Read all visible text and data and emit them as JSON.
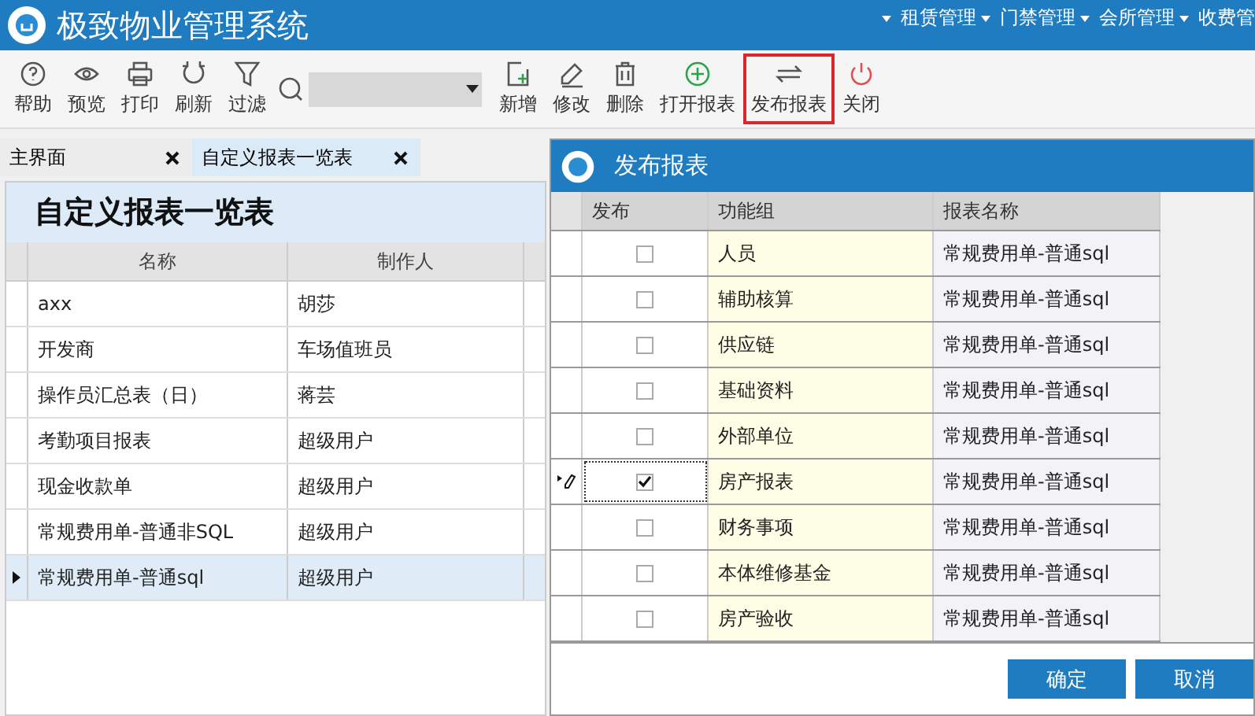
{
  "window": {
    "title": "极致物业管理系统"
  },
  "menus": [
    {
      "label": "租赁管理"
    },
    {
      "label": "门禁管理"
    },
    {
      "label": "会所管理"
    },
    {
      "label": "收费管"
    }
  ],
  "toolbar": {
    "left": [
      {
        "label": "帮助"
      },
      {
        "label": "预览"
      },
      {
        "label": "打印"
      },
      {
        "label": "刷新"
      },
      {
        "label": "过滤"
      }
    ],
    "right": [
      {
        "label": "新增",
        "highlighted": false
      },
      {
        "label": "修改",
        "highlighted": false
      },
      {
        "label": "删除",
        "highlighted": false
      },
      {
        "label": "打开报表",
        "highlighted": false
      },
      {
        "label": "发布报表",
        "highlighted": true
      },
      {
        "label": "关闭",
        "highlighted": false
      }
    ]
  },
  "tabs": [
    {
      "label": "主界面",
      "selected": false
    },
    {
      "label": "自定义报表一览表",
      "selected": true
    }
  ],
  "report_list": {
    "title": "自定义报表一览表",
    "columns": [
      "名称",
      "制作人"
    ],
    "rows": [
      {
        "name": "axx",
        "author": "胡莎",
        "selected": false
      },
      {
        "name": "开发商",
        "author": "车场值班员",
        "selected": false
      },
      {
        "name": "操作员汇总表（日）",
        "author": "蒋芸",
        "selected": false
      },
      {
        "name": "考勤项目报表",
        "author": "超级用户",
        "selected": false
      },
      {
        "name": "现金收款单",
        "author": "超级用户",
        "selected": false
      },
      {
        "name": "常规费用单-普通非SQL",
        "author": "超级用户",
        "selected": false
      },
      {
        "name": "常规费用单-普通sql",
        "author": "超级用户",
        "selected": true
      }
    ]
  },
  "dialog": {
    "title": "发布报表",
    "columns": [
      "发布",
      "功能组",
      "报表名称"
    ],
    "rows": [
      {
        "checked": false,
        "group": "人员",
        "report": "常规费用单-普通sql",
        "selected": false
      },
      {
        "checked": false,
        "group": "辅助核算",
        "report": "常规费用单-普通sql",
        "selected": false
      },
      {
        "checked": false,
        "group": "供应链",
        "report": "常规费用单-普通sql",
        "selected": false
      },
      {
        "checked": false,
        "group": "基础资料",
        "report": "常规费用单-普通sql",
        "selected": false
      },
      {
        "checked": false,
        "group": "外部单位",
        "report": "常规费用单-普通sql",
        "selected": false
      },
      {
        "checked": true,
        "group": "房产报表",
        "report": "常规费用单-普通sql",
        "selected": true
      },
      {
        "checked": false,
        "group": "财务事项",
        "report": "常规费用单-普通sql",
        "selected": false
      },
      {
        "checked": false,
        "group": "本体维修基金",
        "report": "常规费用单-普通sql",
        "selected": false
      },
      {
        "checked": false,
        "group": "房产验收",
        "report": "常规费用单-普通sql",
        "selected": false
      }
    ],
    "buttons": [
      "确定",
      "取消"
    ]
  }
}
